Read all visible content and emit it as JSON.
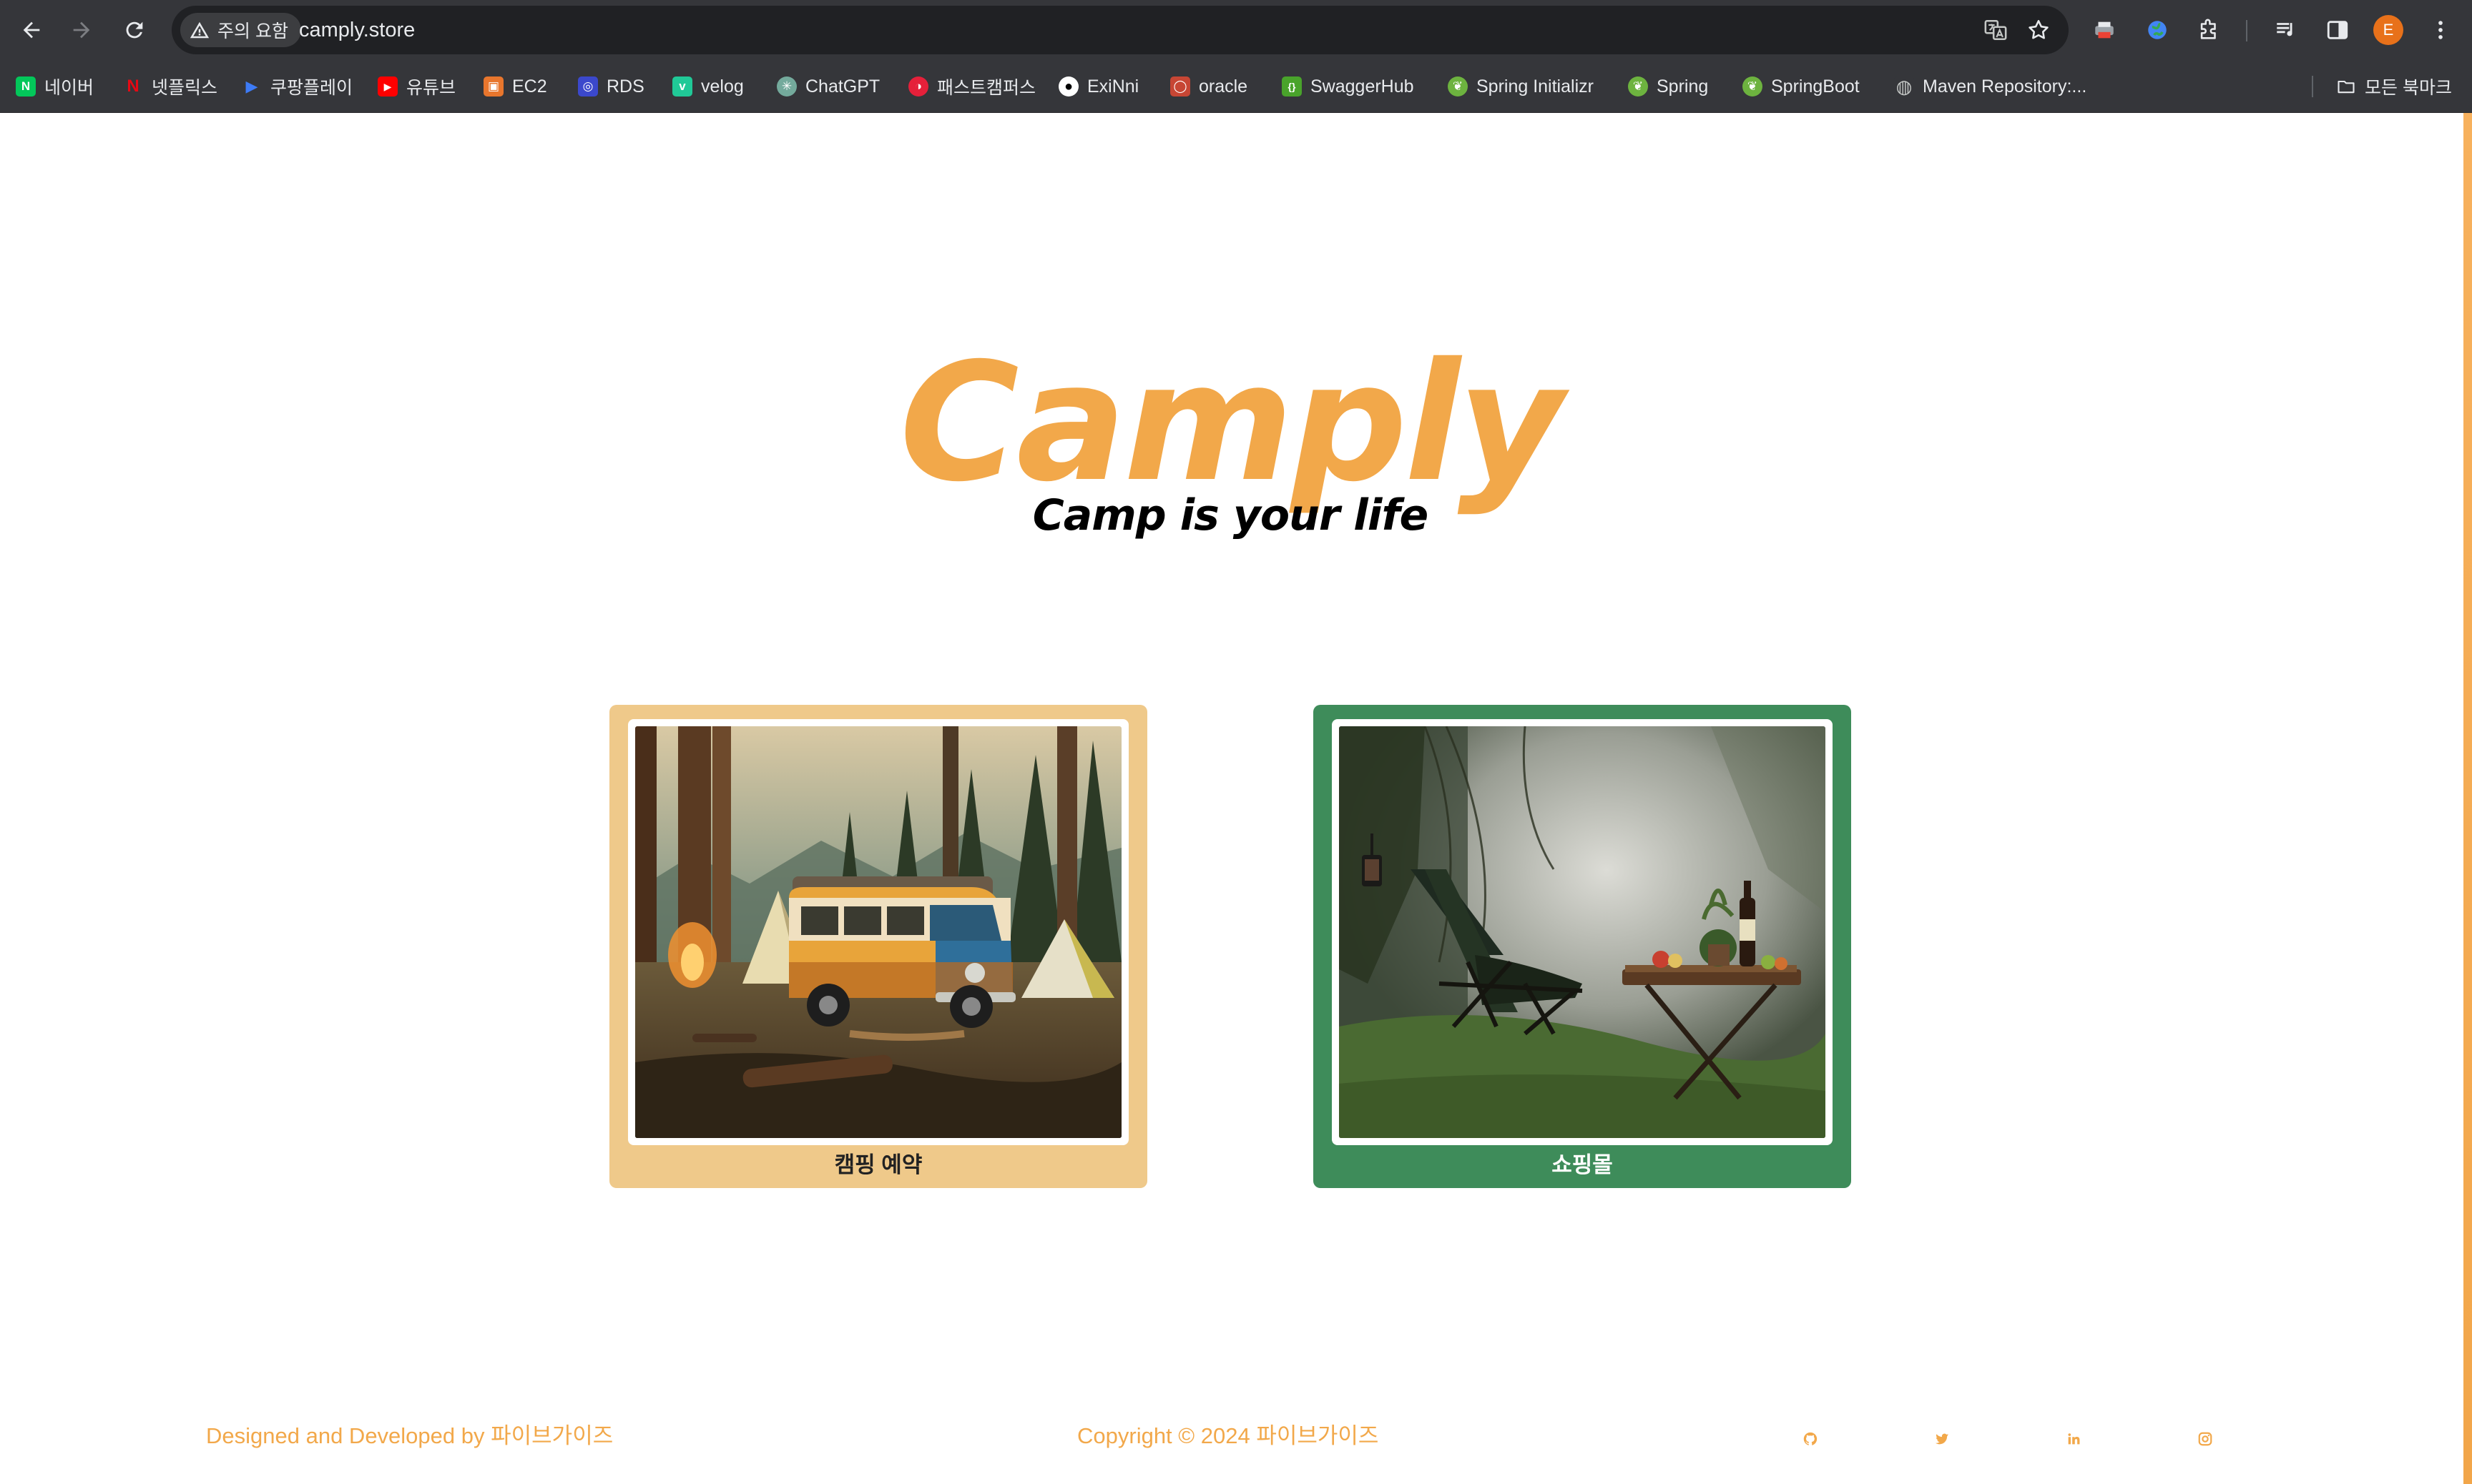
{
  "browser": {
    "security_label": "주의 요함",
    "url": "camply.store",
    "profile_initial": "E",
    "bookmarks": [
      {
        "label": "네이버",
        "icon": "naver-icon",
        "color": "#03c75a",
        "glyph": "N"
      },
      {
        "label": "넷플릭스",
        "icon": "netflix-icon",
        "color": "#e50914",
        "glyph": "N"
      },
      {
        "label": "쿠팡플레이",
        "icon": "coupangplay-icon",
        "color": "#3d7bf6",
        "glyph": "▶"
      },
      {
        "label": "유튜브",
        "icon": "youtube-icon",
        "color": "#ff0000",
        "glyph": "▶"
      },
      {
        "label": "EC2",
        "icon": "aws-ec2-icon",
        "color": "#e8762d",
        "glyph": "▣"
      },
      {
        "label": "RDS",
        "icon": "aws-rds-icon",
        "color": "#3b48cc",
        "glyph": "◎"
      },
      {
        "label": "velog",
        "icon": "velog-icon",
        "color": "#20c997",
        "glyph": "v"
      },
      {
        "label": "ChatGPT",
        "icon": "chatgpt-icon",
        "color": "#74aa9c",
        "glyph": "✳"
      },
      {
        "label": "패스트캠퍼스",
        "icon": "fastcampus-icon",
        "color": "#e5203a",
        "glyph": "◑"
      },
      {
        "label": "ExiNni",
        "icon": "github-icon",
        "color": "#000000",
        "glyph": "●"
      },
      {
        "label": "oracle",
        "icon": "oracle-icon",
        "color": "#c74634",
        "glyph": "◯"
      },
      {
        "label": "SwaggerHub",
        "icon": "swagger-icon",
        "color": "#49a32b",
        "glyph": "{}"
      },
      {
        "label": "Spring Initializr",
        "icon": "spring-icon",
        "color": "#6db33f",
        "glyph": "❦"
      },
      {
        "label": "Spring",
        "icon": "spring-icon",
        "color": "#6db33f",
        "glyph": "❦"
      },
      {
        "label": "SpringBoot",
        "icon": "spring-icon",
        "color": "#6db33f",
        "glyph": "❦"
      },
      {
        "label": "Maven Repository:...",
        "icon": "globe-icon",
        "color": "#5f6368",
        "glyph": "◍"
      }
    ],
    "all_bookmarks_label": "모든 북마크"
  },
  "hero": {
    "title": "Camply",
    "slogan": "Camp is your life"
  },
  "cards": [
    {
      "label": "캠핑 예약",
      "bg_color": "#efc98a"
    },
    {
      "label": "쇼핑몰",
      "bg_color": "#3e8c5a"
    }
  ],
  "footer": {
    "credit": "Designed and Developed by 파이브가이즈",
    "copyright": "Copyright © 2024 파이브가이즈",
    "accent_color": "#f2a84a",
    "social_icons": [
      "github-icon",
      "twitter-icon",
      "linkedin-icon",
      "instagram-icon"
    ]
  }
}
